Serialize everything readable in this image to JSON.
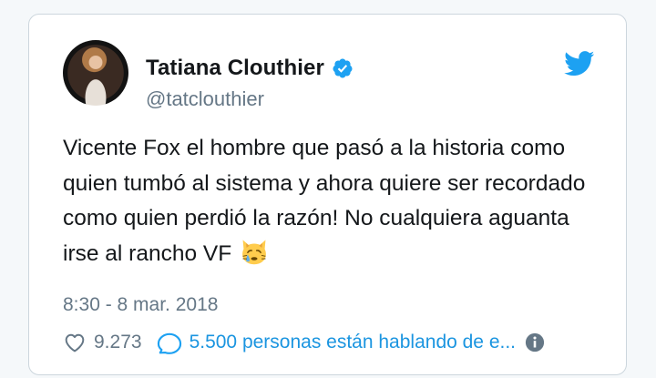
{
  "tweet": {
    "author": {
      "name": "Tatiana Clouthier",
      "handle": "@tatclouthier",
      "verified": true
    },
    "text": "Vicente Fox el hombre que pasó a la historia como quien tumbó al sistema y ahora quiere ser recordado como quien perdió la razón! No cualquiera aguanta irse al rancho VF",
    "emoji": "crying-cat-face",
    "timestamp": "8:30 - 8 mar. 2018",
    "likes": "9.273",
    "conversation": "5.500 personas están hablando de e..."
  },
  "colors": {
    "brand_blue": "#1da1f2",
    "link_blue": "#1b95e0",
    "text_dark": "#14171a",
    "text_gray": "#657786",
    "border": "#ccd6dd"
  },
  "icons": [
    "verified-badge-icon",
    "twitter-bird-icon",
    "heart-icon",
    "reply-bubble-icon",
    "info-icon"
  ]
}
